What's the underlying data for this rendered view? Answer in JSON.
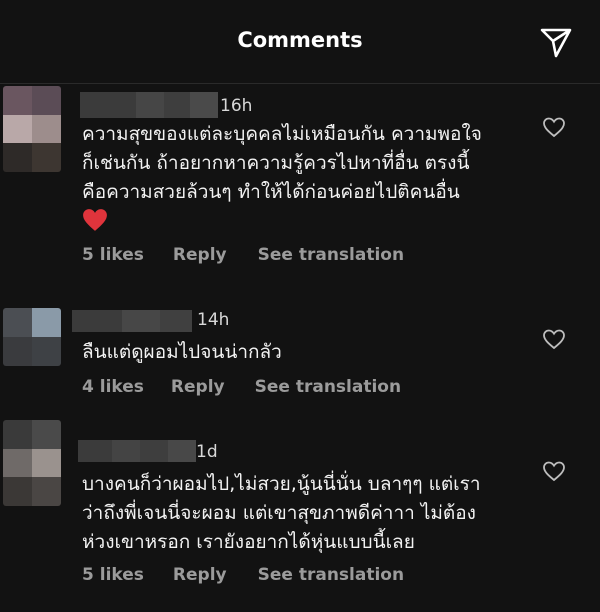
{
  "header": {
    "title": "Comments"
  },
  "icons": {
    "send": "paper-plane-icon",
    "like": "heart-outline-icon",
    "emoji": "red-heart-emoji-icon"
  },
  "colors": {
    "background": "#121212",
    "text": "#f5f5f5",
    "muted": "#9b9b9b",
    "emoji_red": "#e0343c"
  },
  "comments": [
    {
      "time": "16h",
      "text": "ความสุขของแต่ละบุคคลไม่เหมือนกัน ความพอใจ\nก็เช่นกัน ถ้าอยากหาความรู้ควรไปหาที่อื่น ตรงนี้\nคือความสวยล้วนๆ ทำให้ได้ก่อนค่อยไปติคนอื่น",
      "likes": "5 likes",
      "reply": "Reply",
      "translate": "See translation"
    },
    {
      "time": "14h",
      "text": "ลืนแต่ดูผอมไปจนน่ากลัว",
      "likes": "4 likes",
      "reply": "Reply",
      "translate": "See translation"
    },
    {
      "time": "1d",
      "text": "บางคนก็ว่าผอมไป,ไม่สวย,นู้นนี่นั่น บลาๆๆ แต่เรา\nว่าถึงพี่เจนนี่จะผอม แต่เขาสุขภาพดีค่าาา ไม่ต้อง\nห่วงเขาหรอก เรายังอยากได้หุ่นแบบนี้เลย",
      "likes": "5 likes",
      "reply": "Reply",
      "translate": "See translation"
    }
  ]
}
